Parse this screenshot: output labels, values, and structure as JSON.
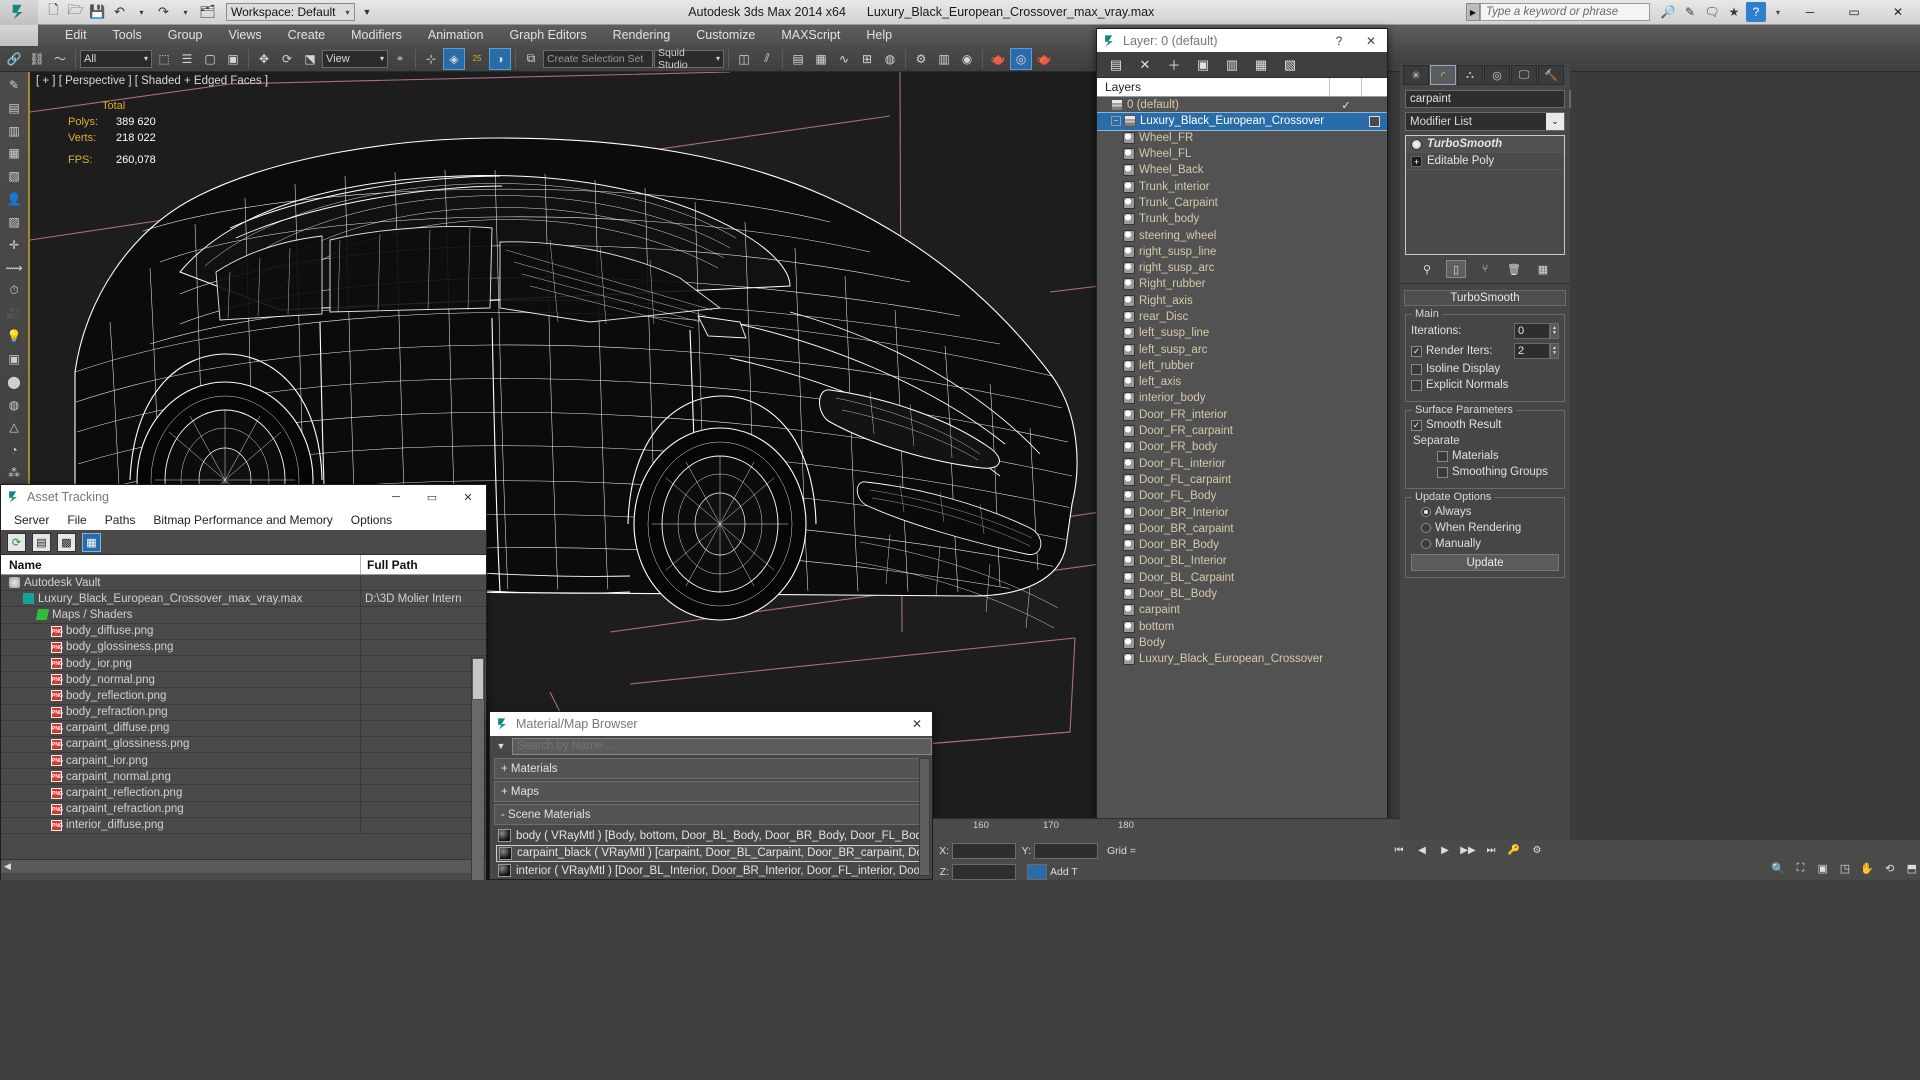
{
  "titlebar": {
    "workspace": "Workspace: Default",
    "app_name": "Autodesk 3ds Max  2014 x64",
    "file_name": "Luxury_Black_European_Crossover_max_vray.max",
    "search_placeholder": "Type a keyword or phrase",
    "qat": [
      "new-icon",
      "open-icon",
      "save-icon",
      "undo-icon",
      "redo-icon",
      "set-project-icon"
    ],
    "window_buttons": [
      "minimize",
      "maximize",
      "close"
    ]
  },
  "menu": {
    "items": [
      "Edit",
      "Tools",
      "Group",
      "Views",
      "Create",
      "Modifiers",
      "Animation",
      "Graph Editors",
      "Rendering",
      "Customize",
      "MAXScript",
      "Help"
    ]
  },
  "toolbar": {
    "filter_value": "All",
    "ref_coord_value": "View",
    "named_selection_placeholder": "Create Selection Set",
    "named_set_value": "Squid Studio",
    "percent_label": "25"
  },
  "viewport": {
    "label": "[ + ] [ Perspective ] [ Shaded + Edged Faces ]",
    "stats_title": "Total",
    "stats": [
      {
        "key": "Polys:",
        "value": "389 620"
      },
      {
        "key": "Verts:",
        "value": "218 022"
      },
      {
        "key": "FPS:",
        "value": "260,078"
      }
    ]
  },
  "asset_tracking": {
    "title": "Asset Tracking",
    "menu": [
      "Server",
      "File",
      "Paths",
      "Bitmap Performance and Memory",
      "Options"
    ],
    "tool_icons": [
      "refresh-icon",
      "list-view-icon",
      "thumbnail-view-icon",
      "grid-view-icon"
    ],
    "columns": [
      "Name",
      "Full Path"
    ],
    "rows": [
      {
        "label": "Autodesk Vault",
        "icon": "vault-icon",
        "indent": 0,
        "path": ""
      },
      {
        "label": "Luxury_Black_European_Crossover_max_vray.max",
        "icon": "max-file-icon",
        "indent": 1,
        "path": "D:\\3D Molier Intern"
      },
      {
        "label": "Maps / Shaders",
        "icon": "maps-icon",
        "indent": 2,
        "path": ""
      },
      {
        "label": "body_diffuse.png",
        "icon": "png-icon",
        "indent": 3,
        "path": ""
      },
      {
        "label": "body_glossiness.png",
        "icon": "png-icon",
        "indent": 3,
        "path": ""
      },
      {
        "label": "body_ior.png",
        "icon": "png-icon",
        "indent": 3,
        "path": ""
      },
      {
        "label": "body_normal.png",
        "icon": "png-icon",
        "indent": 3,
        "path": ""
      },
      {
        "label": "body_reflection.png",
        "icon": "png-icon",
        "indent": 3,
        "path": ""
      },
      {
        "label": "body_refraction.png",
        "icon": "png-icon",
        "indent": 3,
        "path": ""
      },
      {
        "label": "carpaint_diffuse.png",
        "icon": "png-icon",
        "indent": 3,
        "path": ""
      },
      {
        "label": "carpaint_glossiness.png",
        "icon": "png-icon",
        "indent": 3,
        "path": ""
      },
      {
        "label": "carpaint_ior.png",
        "icon": "png-icon",
        "indent": 3,
        "path": ""
      },
      {
        "label": "carpaint_normal.png",
        "icon": "png-icon",
        "indent": 3,
        "path": ""
      },
      {
        "label": "carpaint_reflection.png",
        "icon": "png-icon",
        "indent": 3,
        "path": ""
      },
      {
        "label": "carpaint_refraction.png",
        "icon": "png-icon",
        "indent": 3,
        "path": ""
      },
      {
        "label": "interior_diffuse.png",
        "icon": "png-icon",
        "indent": 3,
        "path": ""
      }
    ]
  },
  "material_browser": {
    "title": "Material/Map Browser",
    "search_placeholder": "Search by Name ...",
    "groups": [
      {
        "label": "+ Materials"
      },
      {
        "label": "+ Maps"
      },
      {
        "label": "- Scene Materials"
      }
    ],
    "scene_materials": [
      {
        "label": "body  ( VRayMtl )  [Body, bottom, Door_BL_Body, Door_BR_Body, Door_FL_Bod...",
        "selected": false
      },
      {
        "label": "carpaint_black  ( VRayMtl )  [carpaint, Door_BL_Carpaint, Door_BR_carpaint, Do...",
        "selected": true
      },
      {
        "label": "interior  ( VRayMtl )  [Door_BL_Interior, Door_BR_Interior, Door_FL_interior, Doo...",
        "selected": false
      }
    ]
  },
  "layer_explorer": {
    "title": "Layer: 0 (default)",
    "toolbar_icons": [
      "new-layer-icon",
      "delete-layer-icon",
      "add-layer-icon",
      "select-objects-icon",
      "select-layer-icon",
      "add-to-layer-icon",
      "layer-settings-icon"
    ],
    "column_header": "Layers",
    "rows": [
      {
        "label": "0 (default)",
        "indent": 0,
        "icon": "layer-icon",
        "selected": false,
        "checked": true,
        "expander": false,
        "box": false
      },
      {
        "label": "Luxury_Black_European_Crossover",
        "indent": 0,
        "icon": "layer-icon",
        "selected": true,
        "checked": false,
        "expander": true,
        "box": true
      },
      {
        "label": "Wheel_FR",
        "indent": 1,
        "icon": "object-icon",
        "selected": false
      },
      {
        "label": "Wheel_FL",
        "indent": 1,
        "icon": "object-icon",
        "selected": false
      },
      {
        "label": "Wheel_Back",
        "indent": 1,
        "icon": "object-icon",
        "selected": false
      },
      {
        "label": "Trunk_interior",
        "indent": 1,
        "icon": "object-icon",
        "selected": false
      },
      {
        "label": "Trunk_Carpaint",
        "indent": 1,
        "icon": "object-icon",
        "selected": false
      },
      {
        "label": "Trunk_body",
        "indent": 1,
        "icon": "object-icon",
        "selected": false
      },
      {
        "label": "steering_wheel",
        "indent": 1,
        "icon": "object-icon",
        "selected": false
      },
      {
        "label": "right_susp_line",
        "indent": 1,
        "icon": "object-icon",
        "selected": false
      },
      {
        "label": "right_susp_arc",
        "indent": 1,
        "icon": "object-icon",
        "selected": false
      },
      {
        "label": "Right_rubber",
        "indent": 1,
        "icon": "object-icon",
        "selected": false
      },
      {
        "label": "Right_axis",
        "indent": 1,
        "icon": "object-icon",
        "selected": false
      },
      {
        "label": "rear_Disc",
        "indent": 1,
        "icon": "object-icon",
        "selected": false
      },
      {
        "label": "left_susp_line",
        "indent": 1,
        "icon": "object-icon",
        "selected": false
      },
      {
        "label": "left_susp_arc",
        "indent": 1,
        "icon": "object-icon",
        "selected": false
      },
      {
        "label": "left_rubber",
        "indent": 1,
        "icon": "object-icon",
        "selected": false
      },
      {
        "label": "left_axis",
        "indent": 1,
        "icon": "object-icon",
        "selected": false
      },
      {
        "label": "interior_body",
        "indent": 1,
        "icon": "object-icon",
        "selected": false
      },
      {
        "label": "Door_FR_interior",
        "indent": 1,
        "icon": "object-icon",
        "selected": false
      },
      {
        "label": "Door_FR_carpaint",
        "indent": 1,
        "icon": "object-icon",
        "selected": false
      },
      {
        "label": "Door_FR_body",
        "indent": 1,
        "icon": "object-icon",
        "selected": false
      },
      {
        "label": "Door_FL_interior",
        "indent": 1,
        "icon": "object-icon",
        "selected": false
      },
      {
        "label": "Door_FL_carpaint",
        "indent": 1,
        "icon": "object-icon",
        "selected": false
      },
      {
        "label": "Door_FL_Body",
        "indent": 1,
        "icon": "object-icon",
        "selected": false
      },
      {
        "label": "Door_BR_Interior",
        "indent": 1,
        "icon": "object-icon",
        "selected": false
      },
      {
        "label": "Door_BR_carpaint",
        "indent": 1,
        "icon": "object-icon",
        "selected": false
      },
      {
        "label": "Door_BR_Body",
        "indent": 1,
        "icon": "object-icon",
        "selected": false
      },
      {
        "label": "Door_BL_Interior",
        "indent": 1,
        "icon": "object-icon",
        "selected": false
      },
      {
        "label": "Door_BL_Carpaint",
        "indent": 1,
        "icon": "object-icon",
        "selected": false
      },
      {
        "label": "Door_BL_Body",
        "indent": 1,
        "icon": "object-icon",
        "selected": false
      },
      {
        "label": "carpaint",
        "indent": 1,
        "icon": "object-icon",
        "selected": false
      },
      {
        "label": "bottom",
        "indent": 1,
        "icon": "object-icon",
        "selected": false
      },
      {
        "label": "Body",
        "indent": 1,
        "icon": "object-icon",
        "selected": false
      },
      {
        "label": "Luxury_Black_European_Crossover",
        "indent": 1,
        "icon": "object-icon",
        "selected": false
      }
    ]
  },
  "command_panel": {
    "tabs": [
      "create-tab",
      "modify-tab",
      "hierarchy-tab",
      "motion-tab",
      "display-tab",
      "utilities-tab"
    ],
    "object_name": "carpaint",
    "modifier_list_label": "Modifier List",
    "stack": [
      {
        "label": "TurboSmooth",
        "active": true
      },
      {
        "label": "Editable Poly",
        "active": false
      }
    ],
    "rollout_title": "TurboSmooth",
    "main_group": "Main",
    "iterations_label": "Iterations:",
    "iterations_value": "0",
    "render_iters_label": "Render Iters:",
    "render_iters_value": "2",
    "render_iters_checked": true,
    "isoline_display_label": "Isoline Display",
    "explicit_normals_label": "Explicit Normals",
    "surface_params_group": "Surface Parameters",
    "smooth_result_label": "Smooth Result",
    "smooth_result_checked": true,
    "separate_label": "Separate",
    "materials_label": "Materials",
    "smoothing_groups_label": "Smoothing Groups",
    "update_options_group": "Update Options",
    "update_modes": [
      "Always",
      "When Rendering",
      "Manually"
    ],
    "update_selected": "Always",
    "update_button": "Update"
  },
  "status": {
    "time_ticks": [
      "160",
      "170",
      "180"
    ],
    "coord_labels": [
      "X:",
      "Y:",
      "Z:"
    ],
    "coord_values": [
      "",
      "",
      ""
    ],
    "grid_label": "Grid =",
    "add_time_tag": "Add T"
  },
  "colors": {
    "accent_blue": "#2a6ca8",
    "layer_text": "#d8c9a8",
    "viewport_bg": "#1d1d1d",
    "wire": "#ffffff",
    "grid_pink": "#c97a92",
    "stats_yellow": "#d7b03a"
  }
}
